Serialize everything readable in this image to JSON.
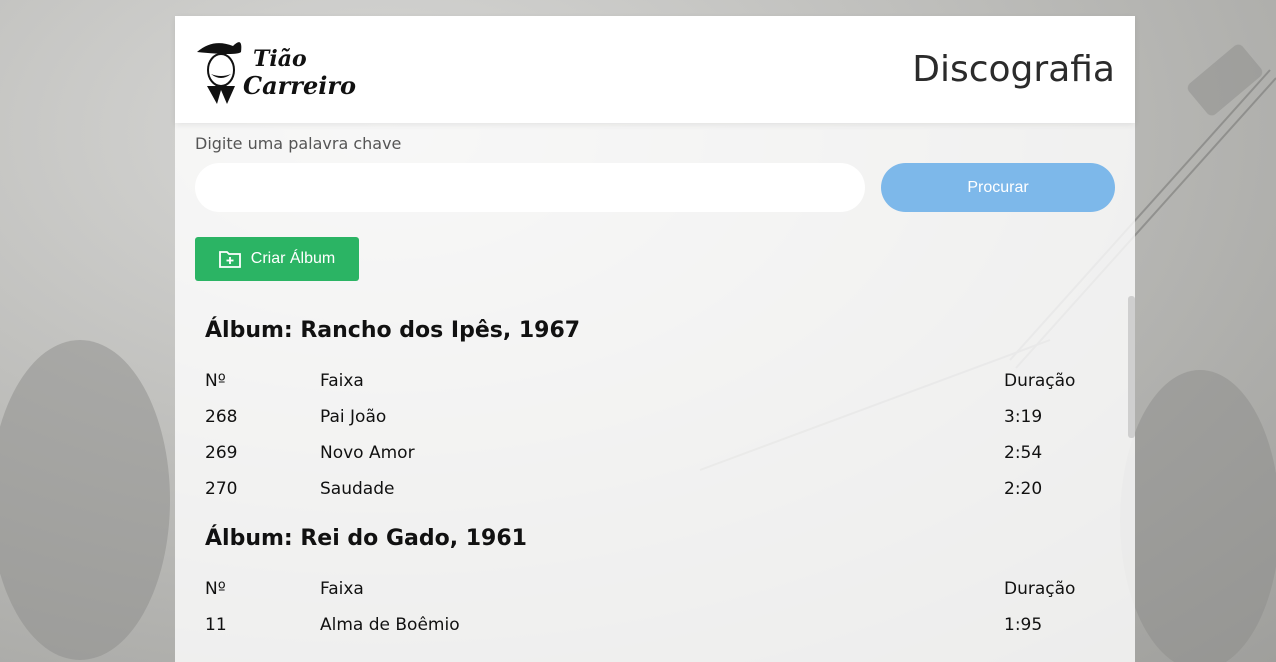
{
  "header": {
    "logo_text": "Tião Carreiro",
    "title": "Discografia"
  },
  "search": {
    "label": "Digite uma palavra chave",
    "value": "",
    "placeholder": "",
    "button_label": "Procurar"
  },
  "actions": {
    "create_album_label": "Criar Álbum"
  },
  "albums": [
    {
      "title": "Álbum: Rancho dos Ipês, 1967",
      "columns": [
        "Nº",
        "Faixa",
        "Duração"
      ],
      "tracks": [
        {
          "number": "268",
          "name": "Pai João",
          "duration": "3:19"
        },
        {
          "number": "269",
          "name": "Novo Amor",
          "duration": "2:54"
        },
        {
          "number": "270",
          "name": "Saudade",
          "duration": "2:20"
        }
      ]
    },
    {
      "title": "Álbum: Rei do Gado, 1961",
      "columns": [
        "Nº",
        "Faixa",
        "Duração"
      ],
      "tracks": [
        {
          "number": "11",
          "name": "Alma de Boêmio",
          "duration": "1:95"
        }
      ]
    }
  ],
  "colors": {
    "search_button": "#7db8ea",
    "create_button": "#2bb464"
  }
}
